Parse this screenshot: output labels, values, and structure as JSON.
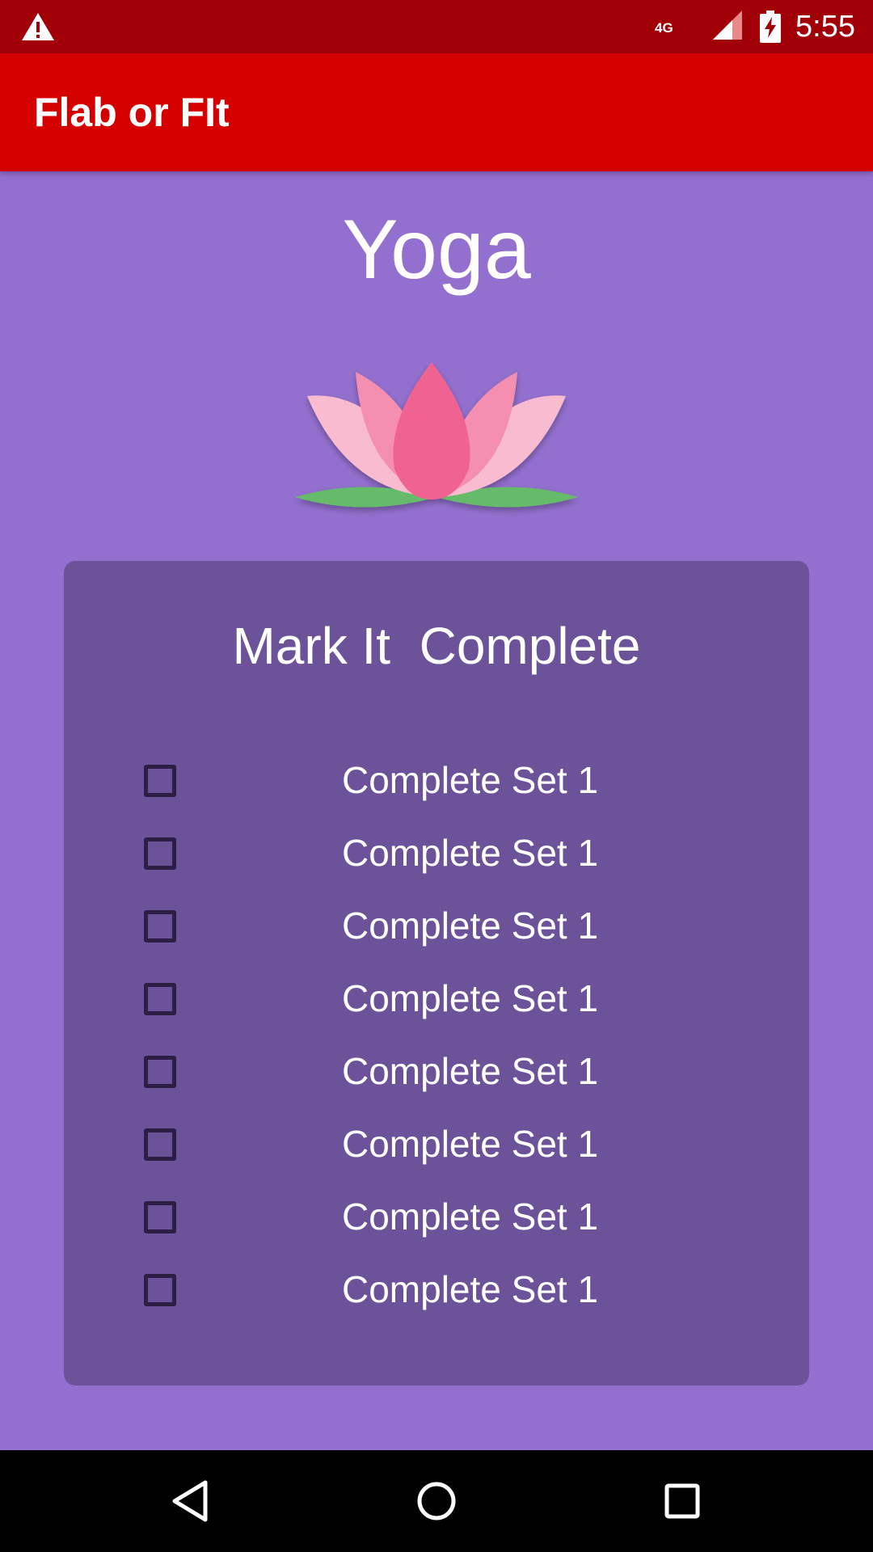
{
  "status_bar": {
    "time": "5:55",
    "network_type": "4G",
    "icons": [
      "warning-icon",
      "signal-icon",
      "battery-charging-icon"
    ]
  },
  "app_bar": {
    "title": "Flab or FIt"
  },
  "main": {
    "title": "Yoga",
    "image": "lotus-illustration",
    "card": {
      "title": "Mark It  Complete",
      "sets": [
        {
          "label": "Complete Set 1",
          "checked": false
        },
        {
          "label": "Complete Set 1",
          "checked": false
        },
        {
          "label": "Complete Set 1",
          "checked": false
        },
        {
          "label": "Complete Set 1",
          "checked": false
        },
        {
          "label": "Complete Set 1",
          "checked": false
        },
        {
          "label": "Complete Set 1",
          "checked": false
        },
        {
          "label": "Complete Set 1",
          "checked": false
        },
        {
          "label": "Complete Set 1",
          "checked": false
        }
      ]
    }
  },
  "nav_bar": {
    "icons": [
      "back-icon",
      "home-icon",
      "recents-icon"
    ]
  },
  "colors": {
    "status_bar": "#a20008",
    "app_bar": "#d40000",
    "background": "#9370cf",
    "card": "#6c5299"
  }
}
